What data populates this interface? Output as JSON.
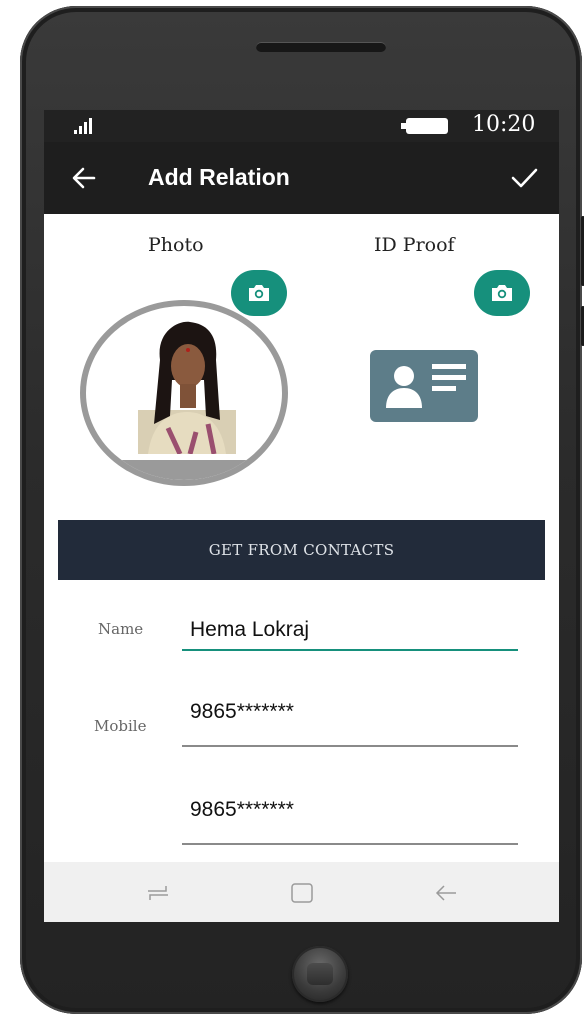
{
  "status_bar": {
    "time": "10:20"
  },
  "app_bar": {
    "title": "Add Relation"
  },
  "media": {
    "photo_label": "Photo",
    "id_proof_label": "ID Proof"
  },
  "contacts_button": "GET FROM CONTACTS",
  "form": {
    "name_label": "Name",
    "name_value": "Hema Lokraj",
    "mobile_label": "Mobile",
    "mobile_value": "9865*******",
    "second_mobile_value": "9865*******"
  },
  "icons": {
    "back": "arrow-left-icon",
    "confirm": "checkmark-icon",
    "camera": "camera-icon",
    "id_card": "id-card-icon",
    "nav_recents": "recents-icon",
    "nav_home": "home-icon",
    "nav_back": "back-icon"
  },
  "colors": {
    "accent": "#16907c",
    "app_bar": "#1e1e1e",
    "contacts_button_bg": "#222b3a",
    "id_card": "#5d7d89"
  }
}
